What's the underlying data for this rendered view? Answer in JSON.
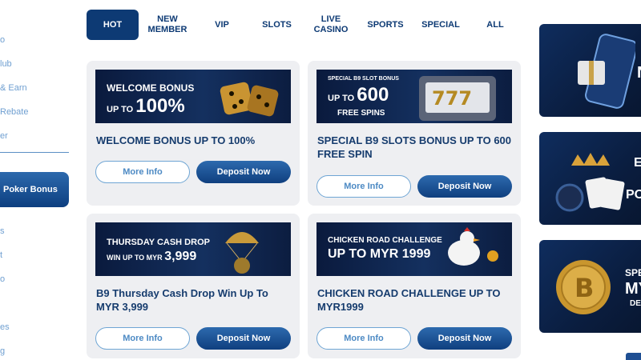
{
  "sidebar": {
    "items": [
      {
        "label": "o"
      },
      {
        "label": "lub"
      },
      {
        "label": "& Earn"
      },
      {
        "label": "Rebate"
      },
      {
        "label": "er"
      }
    ],
    "button_label": "Poker Bonus",
    "items_lower": [
      {
        "label": "s"
      },
      {
        "label": "t"
      },
      {
        "label": "o"
      },
      {
        "label": "es"
      },
      {
        "label": "g"
      }
    ]
  },
  "tabs": [
    {
      "label": "HOT",
      "active": true
    },
    {
      "label": "NEW MEMBER",
      "active": false
    },
    {
      "label": "VIP",
      "active": false
    },
    {
      "label": "SLOTS",
      "active": false
    },
    {
      "label": "LIVE CASINO",
      "active": false
    },
    {
      "label": "SPORTS",
      "active": false
    },
    {
      "label": "SPECIAL",
      "active": false
    },
    {
      "label": "ALL",
      "active": false
    }
  ],
  "cards": [
    {
      "banner_line1": "WELCOME BONUS",
      "banner_line2_prefix": "UP TO",
      "banner_line2_value": "100%",
      "title": "WELCOME BONUS UP TO 100%",
      "more_label": "More Info",
      "deposit_label": "Deposit Now"
    },
    {
      "banner_line1": "SPECIAL B9 SLOT BONUS",
      "banner_line2_prefix": "UP TO",
      "banner_line2_value": "600",
      "banner_line3": "FREE SPINS",
      "title": "SPECIAL B9 SLOTS BONUS UP TO 600 FREE SPIN",
      "more_label": "More Info",
      "deposit_label": "Deposit Now"
    },
    {
      "banner_line1": "THURSDAY CASH DROP",
      "banner_line2_prefix": "WIN UP TO MYR",
      "banner_line2_value": "3,999",
      "title": "B9 Thursday Cash Drop Win Up To MYR 3,999",
      "more_label": "More Info",
      "deposit_label": "Deposit Now"
    },
    {
      "banner_line1": "CHICKEN ROAD CHALLENGE",
      "banner_line2_prefix": "UP TO MYR",
      "banner_line2_value": "1999",
      "title": "CHICKEN ROAD CHALLENGE UP TO MYR1999",
      "more_label": "More Info",
      "deposit_label": "Deposit Now"
    }
  ],
  "promos": [
    {
      "text": "N"
    },
    {
      "text_top": "E",
      "text_bottom": "PO"
    },
    {
      "text_top": "SPE",
      "text_mid": "MY",
      "text_bottom": "DE"
    }
  ],
  "colors": {
    "brand_navy": "#0d3a74",
    "accent_blue": "#2d6aae",
    "link_blue": "#6f9fd1",
    "card_bg": "#eeeff2",
    "gold": "#d9a23a"
  }
}
